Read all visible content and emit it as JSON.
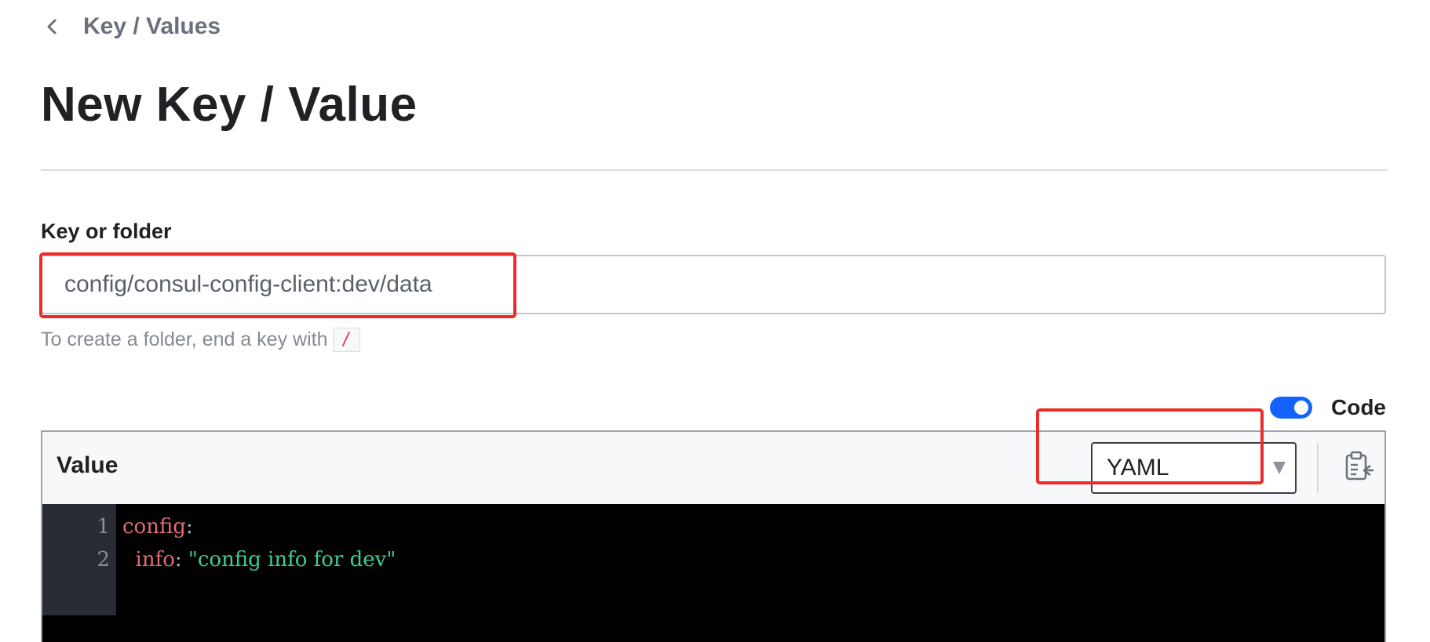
{
  "breadcrumb": {
    "back_label": "Key / Values"
  },
  "page": {
    "title": "New Key / Value"
  },
  "key_field": {
    "label": "Key or folder",
    "value": "config/consul-config-client:dev/data",
    "hint_text": "To create a folder, end a key with",
    "hint_code": "/"
  },
  "code_toggle": {
    "label": "Code",
    "enabled": true
  },
  "editor": {
    "title": "Value",
    "language": "YAML",
    "lines": [
      {
        "num": "1",
        "key": "config",
        "punct": ":",
        "string": ""
      },
      {
        "num": "2",
        "key": "  info",
        "punct": ": ",
        "string": "\"config info for dev\""
      }
    ]
  },
  "colors": {
    "accent": "#1563ff",
    "highlight": "#ee2a2a",
    "code_key": "#e06c75",
    "code_string": "#3ccf91"
  }
}
